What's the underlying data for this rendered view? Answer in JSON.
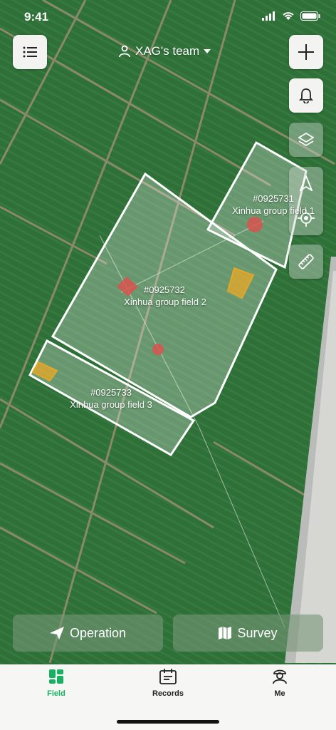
{
  "status_bar": {
    "time": "9:41"
  },
  "header": {
    "team_name": "XAG's team"
  },
  "fields": [
    {
      "id": "#0925731",
      "name": "Xinhua group field 1"
    },
    {
      "id": "#0925732",
      "name": "Xinhua group field 2"
    },
    {
      "id": "#0925733",
      "name": "Xinhua group field 3"
    }
  ],
  "actions": {
    "operation_label": "Operation",
    "survey_label": "Survey"
  },
  "tabs": [
    {
      "label": "Field",
      "active": true
    },
    {
      "label": "Records",
      "active": false
    },
    {
      "label": "Me",
      "active": false
    }
  ],
  "icons": [
    "list-icon",
    "person-icon",
    "caret-down-icon",
    "plus-icon",
    "bell-icon",
    "layers-icon",
    "navigate-icon",
    "locate-icon",
    "ruler-icon",
    "send-icon",
    "map-icon",
    "field-icon",
    "records-icon",
    "me-icon"
  ],
  "colors": {
    "accent": "#16b262",
    "field_border": "#ffffff",
    "obstacle": "#e2a72a",
    "danger": "#d9534f"
  }
}
